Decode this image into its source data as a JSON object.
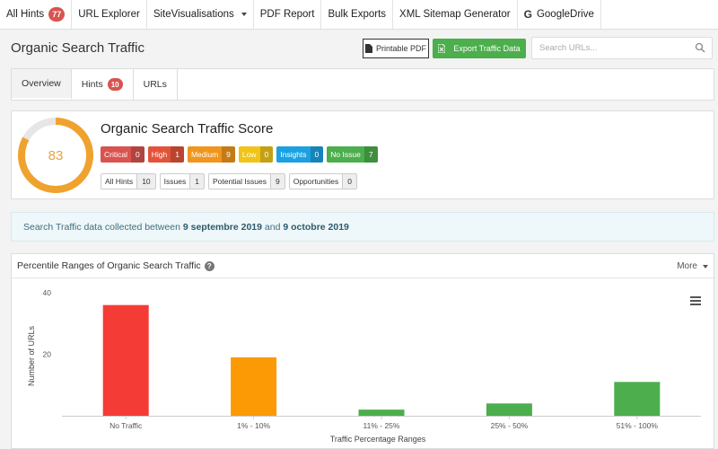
{
  "nav": {
    "all_hints": "All Hints",
    "all_hints_count": "77",
    "url_explorer": "URL Explorer",
    "site_visualisations": "SiteVisualisations",
    "pdf_report": "PDF Report",
    "bulk_exports": "Bulk Exports",
    "xml_sitemap": "XML Sitemap Generator",
    "google_drive": "GoogleDrive",
    "google_icon": "G"
  },
  "header": {
    "title": "Organic Search Traffic",
    "printable_pdf": "Printable PDF",
    "export": "Export Traffic Data",
    "search_placeholder": "Search URLs..."
  },
  "tabs": {
    "overview": "Overview",
    "hints": "Hints",
    "hints_count": "10",
    "urls": "URLs"
  },
  "score": {
    "value": "83",
    "value_fraction": 0.83,
    "title": "Organic Search Traffic Score",
    "severities": [
      {
        "label": "Critical",
        "count": "0",
        "color": "#d9534f"
      },
      {
        "label": "High",
        "count": "1",
        "color": "#e2533a"
      },
      {
        "label": "Medium",
        "count": "9",
        "color": "#f0961d"
      },
      {
        "label": "Low",
        "count": "0",
        "color": "#f0c419"
      },
      {
        "label": "Insights",
        "count": "0",
        "color": "#1ba1e2"
      },
      {
        "label": "No Issue",
        "count": "7",
        "color": "#4cae4c"
      }
    ],
    "issues": [
      {
        "label": "All Hints",
        "count": "10"
      },
      {
        "label": "Issues",
        "count": "1"
      },
      {
        "label": "Potential Issues",
        "count": "9"
      },
      {
        "label": "Opportunities",
        "count": "0"
      }
    ]
  },
  "info": {
    "prefix": "Search Traffic data collected between",
    "start": "9 septembre 2019",
    "and": "and",
    "end": "9 octobre 2019"
  },
  "chart_panel": {
    "title": "Percentile Ranges of Organic Search Traffic",
    "more": "More"
  },
  "chart_data": {
    "type": "bar",
    "title": "",
    "xlabel": "Traffic Percentage Ranges",
    "ylabel": "Number of URLs",
    "categories": [
      "No Traffic",
      "1% - 10%",
      "11% - 25%",
      "25% - 50%",
      "51% - 100%"
    ],
    "values": [
      36,
      19,
      2,
      4,
      11
    ],
    "colors": [
      "#f53b36",
      "#fb9a05",
      "#4cae4c",
      "#4cae4c",
      "#4cae4c"
    ],
    "yticks": [
      20,
      40
    ],
    "ylim": [
      0,
      40
    ],
    "grid": false
  }
}
